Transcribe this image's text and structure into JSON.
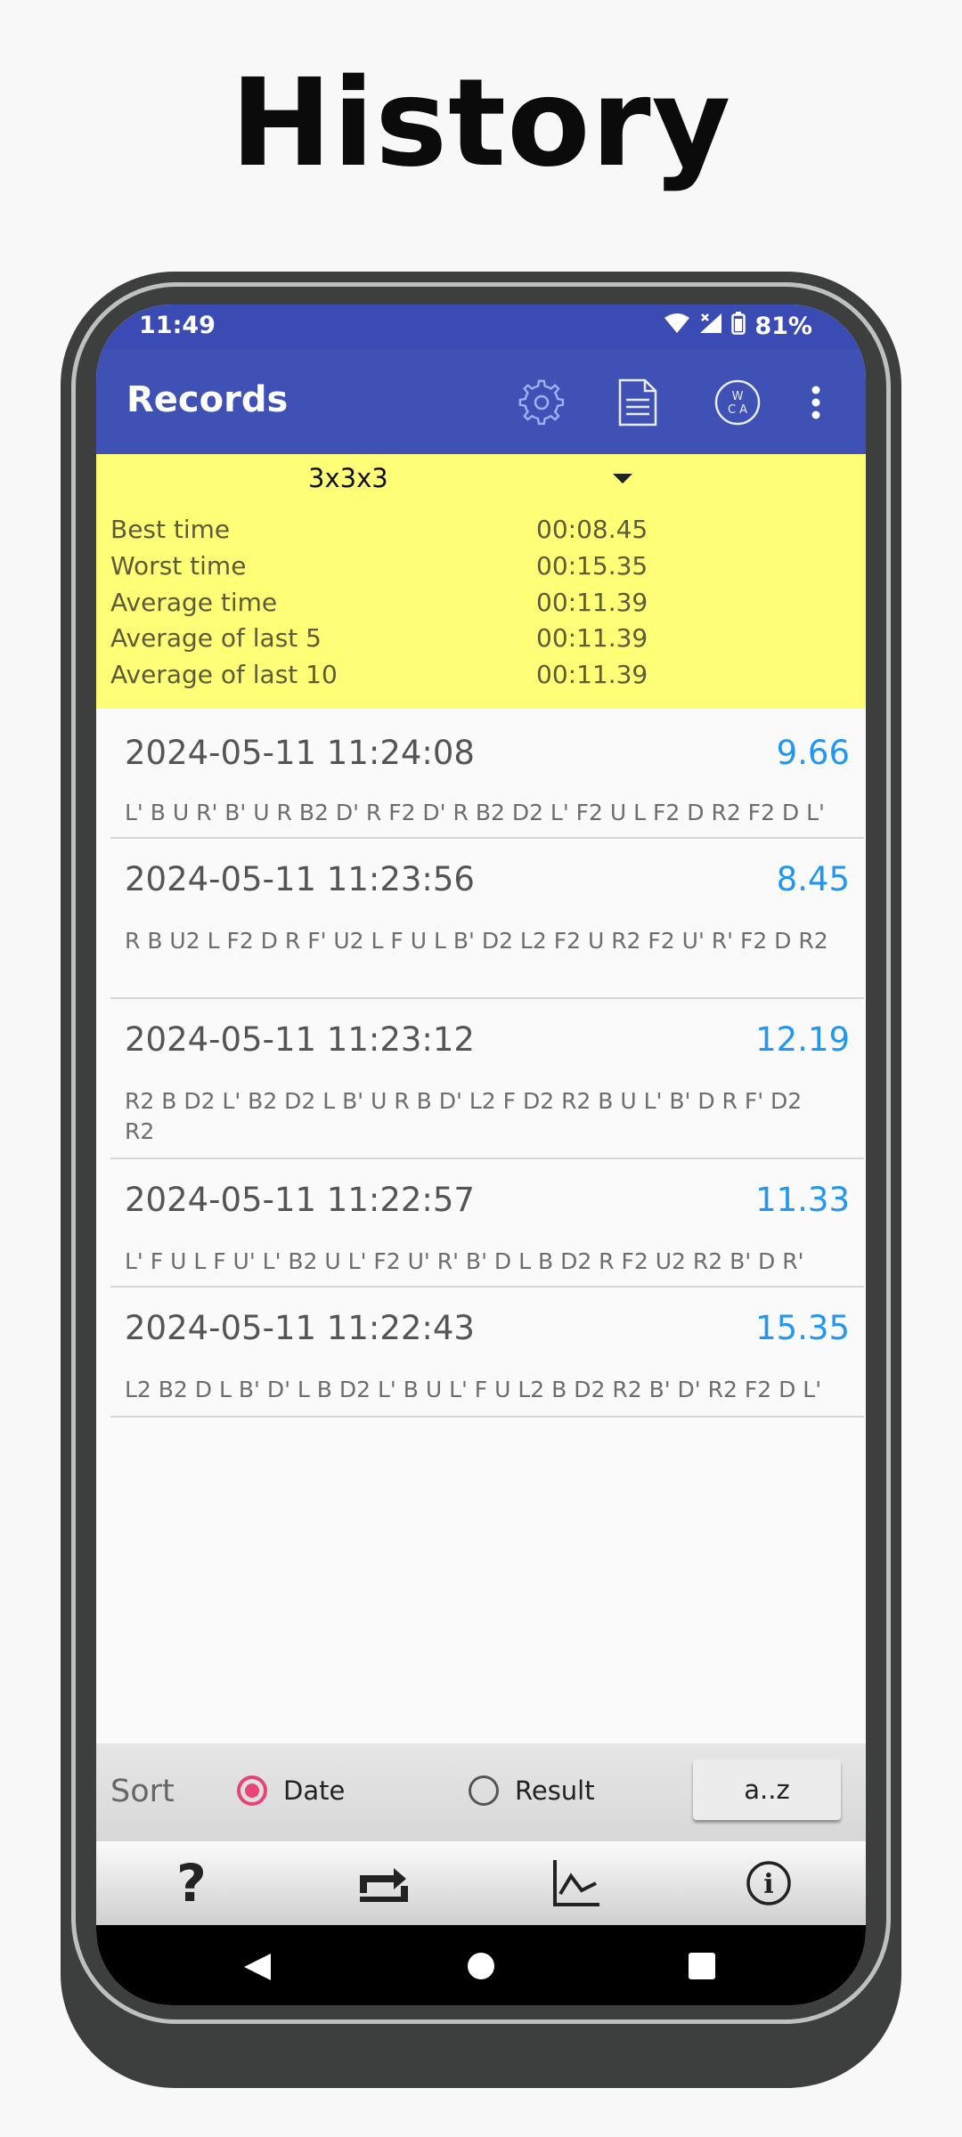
{
  "page": {
    "title": "History"
  },
  "status_bar": {
    "time": "11:49",
    "battery": "81%"
  },
  "app_bar": {
    "title": "Records",
    "actions": [
      "settings-gear-icon",
      "document-icon",
      "wca-icon",
      "more-vert-icon"
    ],
    "wca_top": "W",
    "wca_bottom": "C A"
  },
  "stats": {
    "puzzle": "3x3x3",
    "rows": [
      {
        "label": "Best time",
        "value": "00:08.45"
      },
      {
        "label": "Worst time",
        "value": "00:15.35"
      },
      {
        "label": "Average time",
        "value": "00:11.39"
      },
      {
        "label": "Average of last 5",
        "value": "00:11.39"
      },
      {
        "label": "Average of last 10",
        "value": "00:11.39"
      }
    ]
  },
  "records": [
    {
      "date": "2024-05-11 11:24:08",
      "time": "9.66",
      "scramble": "L' B U R' B' U R B2 D' R F2 D' R B2 D2 L' F2 U L F2 D R2 F2 D L'"
    },
    {
      "date": "2024-05-11 11:23:56",
      "time": "8.45",
      "scramble": "R B U2 L F2 D R F' U2 L F U L B' D2 L2 F2 U R2 F2 U' R' F2 D R2"
    },
    {
      "date": "2024-05-11 11:23:12",
      "time": "12.19",
      "scramble": "R2 B D2 L' B2 D2 L B' U R B D' L2 F D2 R2 B U L' B' D R F' D2 R2"
    },
    {
      "date": "2024-05-11 11:22:57",
      "time": "11.33",
      "scramble": "L' F U L F U' L' B2 U L' F2 U' R' B' D L B D2 R F2 U2 R2 B' D R'"
    },
    {
      "date": "2024-05-11 11:22:43",
      "time": "15.35",
      "scramble": "L2 B2 D L B' D' L B D2 L' B U L' F U L2 B D2 R2 B' D' R2 F2 D L'"
    }
  ],
  "sort": {
    "label": "Sort",
    "options": [
      {
        "label": "Date",
        "selected": true
      },
      {
        "label": "Result",
        "selected": false
      }
    ],
    "order_button": "a..z"
  },
  "toolbar": {
    "items": [
      "help-icon",
      "swap-icon",
      "chart-icon",
      "info-icon"
    ],
    "help_glyph": "?",
    "info_glyph": "i"
  },
  "nav": [
    "back-icon",
    "home-icon",
    "recents-icon"
  ],
  "colors": {
    "app_bar": "#3f51b5",
    "status_bar": "#3a4bb4",
    "stats_bg": "#ffff77",
    "result_blue": "#2196f3",
    "radio_accent": "#e94478"
  }
}
